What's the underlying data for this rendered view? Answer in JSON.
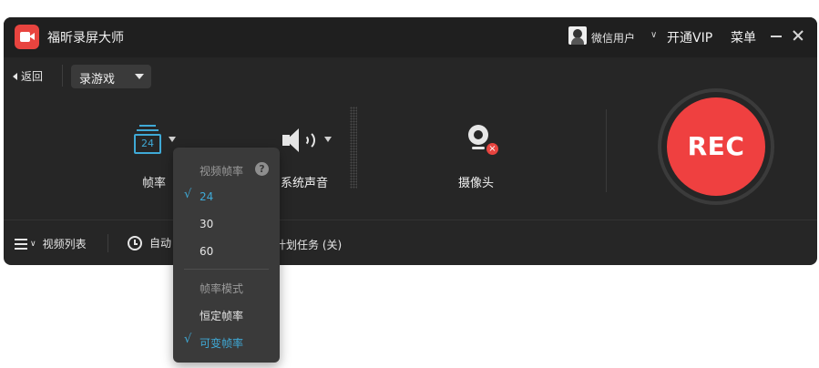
{
  "titlebar": {
    "app_title": "福昕录屏大师",
    "user_name": "微信用户",
    "vip_label": "开通VIP",
    "menu_label": "菜单"
  },
  "toolbar": {
    "back_label": "返回",
    "mode_label": "录游戏"
  },
  "controls": {
    "frame_rate_value": "24",
    "frame_rate_label": "帧率",
    "audio_label": "系统声音",
    "camera_label": "摄像头",
    "camera_off_glyph": "×"
  },
  "rec": {
    "label": "REC",
    "color": "#ef4040"
  },
  "bottom": {
    "video_list_label": "视频列表",
    "auto_label": "自动",
    "schedule_label": "计划任务 (关)"
  },
  "dropdown": {
    "header_rate": "视频帧率",
    "help_glyph": "?",
    "rates": [
      {
        "label": "24",
        "selected": true
      },
      {
        "label": "30",
        "selected": false
      },
      {
        "label": "60",
        "selected": false
      }
    ],
    "header_mode": "帧率模式",
    "modes": [
      {
        "label": "恒定帧率",
        "selected": false
      },
      {
        "label": "可变帧率",
        "selected": true
      }
    ],
    "check_glyph": "√",
    "accent_color": "#3fa9d6"
  }
}
